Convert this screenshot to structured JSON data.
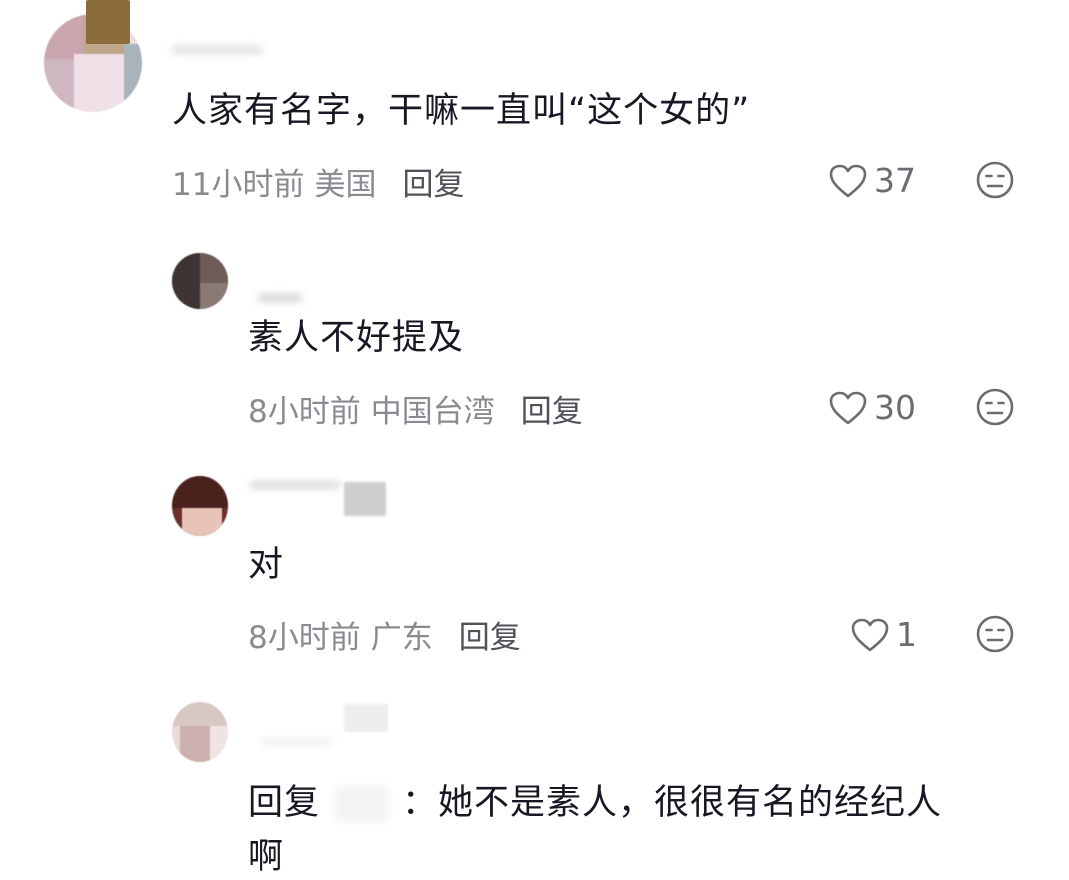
{
  "comments": [
    {
      "text": "人家有名字，干嘛一直叫“这个女的”",
      "time": "11小时前",
      "location": "美国",
      "reply_label": "回复",
      "likes": "37"
    },
    {
      "text": "素人不好提及",
      "time": "8小时前",
      "location": "中国台湾",
      "reply_label": "回复",
      "likes": "30"
    },
    {
      "text": "对",
      "time": "8小时前",
      "location": "广东",
      "reply_label": "回复",
      "likes": "1"
    },
    {
      "reply_prefix": "回复",
      "reply_colon": "：",
      "text_line1": "她不是素人，很很有名的经纪人",
      "text_line2": "啊"
    }
  ],
  "icons": {
    "like": "heart-outline-icon",
    "dislike": "neutral-face-icon"
  },
  "colors": {
    "text": "#161823",
    "meta": "#8a8b91",
    "reply": "#505259",
    "icon": "#6b6c72"
  }
}
